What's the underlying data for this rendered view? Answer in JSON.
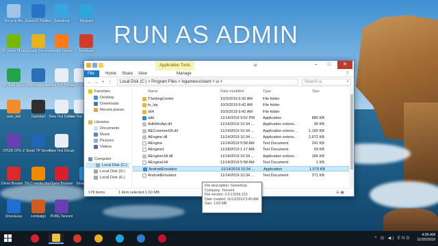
{
  "overlay_title": "RUN AS ADMIN",
  "desktop_icons": [
    {
      "label": "Recycle Bin",
      "color": "#9fc4e6"
    },
    {
      "label": "EaseUS Partition ...",
      "color": "#2a73c8"
    },
    {
      "label": "Gameloop",
      "color": "#3aa5e0"
    },
    {
      "label": "Telegram",
      "color": "#2ea6da"
    },
    {
      "label": "3D Vision Photo Viewer",
      "color": "#76b900"
    },
    {
      "label": "Google Chrome",
      "color": "#e8b21f"
    },
    {
      "label": "Mozilla Firefox",
      "color": "#ff7a1a"
    },
    {
      "label": "Bandicam",
      "color": "#d23a2a"
    },
    {
      "label": "360 Total Security",
      "color": "#22a34a"
    },
    {
      "label": "iObit Uninstaller",
      "color": "#2b6fb8"
    },
    {
      "label": "New Text Document",
      "color": "#e8eef5"
    },
    {
      "label": "New Text Document",
      "color": "#e8eef5"
    },
    {
      "label": "auto_link",
      "color": "#f28c28"
    },
    {
      "label": "Gamstart",
      "color": "#2f2f2f"
    },
    {
      "label": "New Text Docume...",
      "color": "#e8eef5"
    },
    {
      "label": "New Text Docume...",
      "color": "#e8eef5"
    },
    {
      "label": "CPUID CPU-Z",
      "color": "#6a3fb0"
    },
    {
      "label": "Smart TP Server",
      "color": "#2166b5"
    },
    {
      "label": "New Text Docume...",
      "color": "#e8eef5"
    },
    {
      "label": "Driver Booster 7",
      "color": "#d92b2b"
    },
    {
      "label": "VLC media player",
      "color": "#f28a00"
    },
    {
      "label": "Opera Browser",
      "color": "#d6202e"
    },
    {
      "label": "Smart Defrag",
      "color": "#2a8fd8"
    },
    {
      "label": "DriverEasy",
      "color": "#1f6fd0"
    },
    {
      "label": "combatgo",
      "color": "#d25b20"
    },
    {
      "label": "PUBG Tencent",
      "color": "#6a3fb0"
    }
  ],
  "window": {
    "title": "ui",
    "contextual_tab": "Application Tools",
    "tabs": [
      "File",
      "Home",
      "Share",
      "View",
      "Manage"
    ],
    "path": "Local Disk (C:)  >  Program Files  >  txgamesccistant  >  ui  >",
    "search_placeholder": "Search ui",
    "columns": {
      "name": "Name",
      "date": "Date modified",
      "type": "Type",
      "size": "Size"
    },
    "nav": {
      "favorites": "Favorites",
      "desktop": "Desktop",
      "downloads": "Downloads",
      "recent": "Recent places",
      "libraries": "Libraries",
      "documents": "Documents",
      "music": "Music",
      "pictures": "Pictures",
      "videos": "Videos",
      "computer": "Computer",
      "local_c": "Local Disk (C:)",
      "local_d": "Local Disk (D:)",
      "local_e": "Local Disk (E:)"
    },
    "files": [
      {
        "name": "TSettingCenter",
        "date": "10/3/2019 6:42 AM",
        "type": "File folder",
        "size": "",
        "icon": "folder"
      },
      {
        "name": "tx_lsp",
        "date": "10/3/2019 6:42 AM",
        "type": "File folder",
        "size": "",
        "icon": "folder"
      },
      {
        "name": "x64",
        "date": "10/3/2019 6:42 AM",
        "type": "File folder",
        "size": "",
        "icon": "folder"
      },
      {
        "name": "adb",
        "date": "11/14/2019 9:52 PM",
        "type": "Application",
        "size": "880 KB",
        "icon": "app"
      },
      {
        "name": "AdbWinApi.dll",
        "date": "11/14/2019 10:34 ...",
        "type": "Application extens...",
        "size": "95 KB",
        "icon": "dll"
      },
      {
        "name": "AECommonDll.dll",
        "date": "11/14/2019 10:34 ...",
        "type": "Application extens...",
        "size": "1,165 KB",
        "icon": "dll"
      },
      {
        "name": "AEngine.dll",
        "date": "11/14/2019 10:34 ...",
        "type": "Application extens...",
        "size": "2,672 KB",
        "icon": "dll"
      },
      {
        "name": "AEngine",
        "date": "11/14/2019 5:58 AM",
        "type": "Text Document",
        "size": "241 KB",
        "icon": "txt"
      },
      {
        "name": "AEngine1",
        "date": "11/18/2019 1:17 AM",
        "type": "Text Document",
        "size": "69 KB",
        "icon": "txt"
      },
      {
        "name": "AEngineUtil.dll",
        "date": "11/14/2019 10:34 ...",
        "type": "Application extens...",
        "size": "186 KB",
        "icon": "dll"
      },
      {
        "name": "AEngineUtil",
        "date": "11/14/2019 5:58 AM",
        "type": "Text Document",
        "size": "1 KB",
        "icon": "txt"
      },
      {
        "name": "AndroidEmulator",
        "date": "11/14/2019 10:34 ...",
        "type": "Application",
        "size": "1,679 KB",
        "icon": "app",
        "selected": true
      },
      {
        "name": "AndroidEmulator",
        "date": "11/14/2019 10:34 ...",
        "type": "Text Document",
        "size": "371 KB",
        "icon": "txt"
      }
    ],
    "status_count": "178 items",
    "status_selected": "1 item selected  1.63 MB",
    "tooltip": {
      "description": "File description: Gameloop",
      "company": "Company: Tencent",
      "version": "File version: 2.0.13166.123",
      "created": "Date created: 11/12/2019 5:45 AM",
      "size": "Size: 1.63 MB"
    }
  },
  "taskbar": {
    "time": "4:05 AM",
    "date": "11/25/2019",
    "tray_icons": "^  ⊡  ◀)  ENG",
    "apps": [
      {
        "name": "opera",
        "color": "#d6202e"
      },
      {
        "name": "explorer",
        "color": "#f0c040",
        "active": true
      },
      {
        "name": "bandicam",
        "color": "#d23a2a"
      },
      {
        "name": "chrome",
        "color": "#e8b21f"
      },
      {
        "name": "gameloop",
        "color": "#1aa7e0"
      },
      {
        "name": "edge",
        "color": "#2b7dd1"
      },
      {
        "name": "recorder",
        "color": "#c8102e"
      }
    ]
  }
}
